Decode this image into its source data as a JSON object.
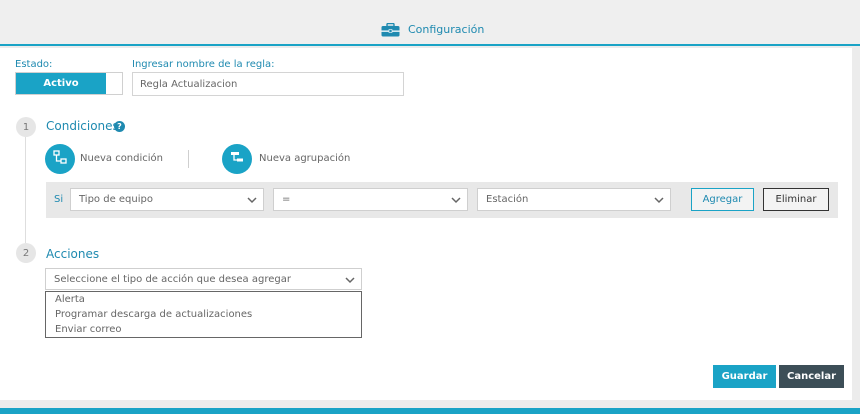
{
  "header": {
    "title": "Configuración",
    "icon": "briefcase-icon",
    "accent": "#1aa3c6"
  },
  "form": {
    "estado_label": "Estado:",
    "estado_value": "Activo",
    "nombre_label": "Ingresar nombre de la regla:",
    "nombre_value": "Regla Actualizacion"
  },
  "condiciones": {
    "step": "1",
    "title": "Condiciones",
    "help": "?",
    "nueva_condicion": "Nueva condición",
    "nueva_agrupacion": "Nueva agrupación",
    "row": {
      "prefix": "Si",
      "field": "Tipo de equipo",
      "operator": "=",
      "value": "Estación",
      "add_label": "Agregar",
      "remove_label": "Eliminar"
    }
  },
  "acciones": {
    "step": "2",
    "title": "Acciones",
    "select_value": "Seleccione el tipo de acción que desea agregar",
    "options": [
      "Alerta",
      "Programar descarga de actualizaciones",
      "Enviar correo"
    ]
  },
  "footer": {
    "save_label": "Guardar",
    "cancel_label": "Cancelar"
  }
}
